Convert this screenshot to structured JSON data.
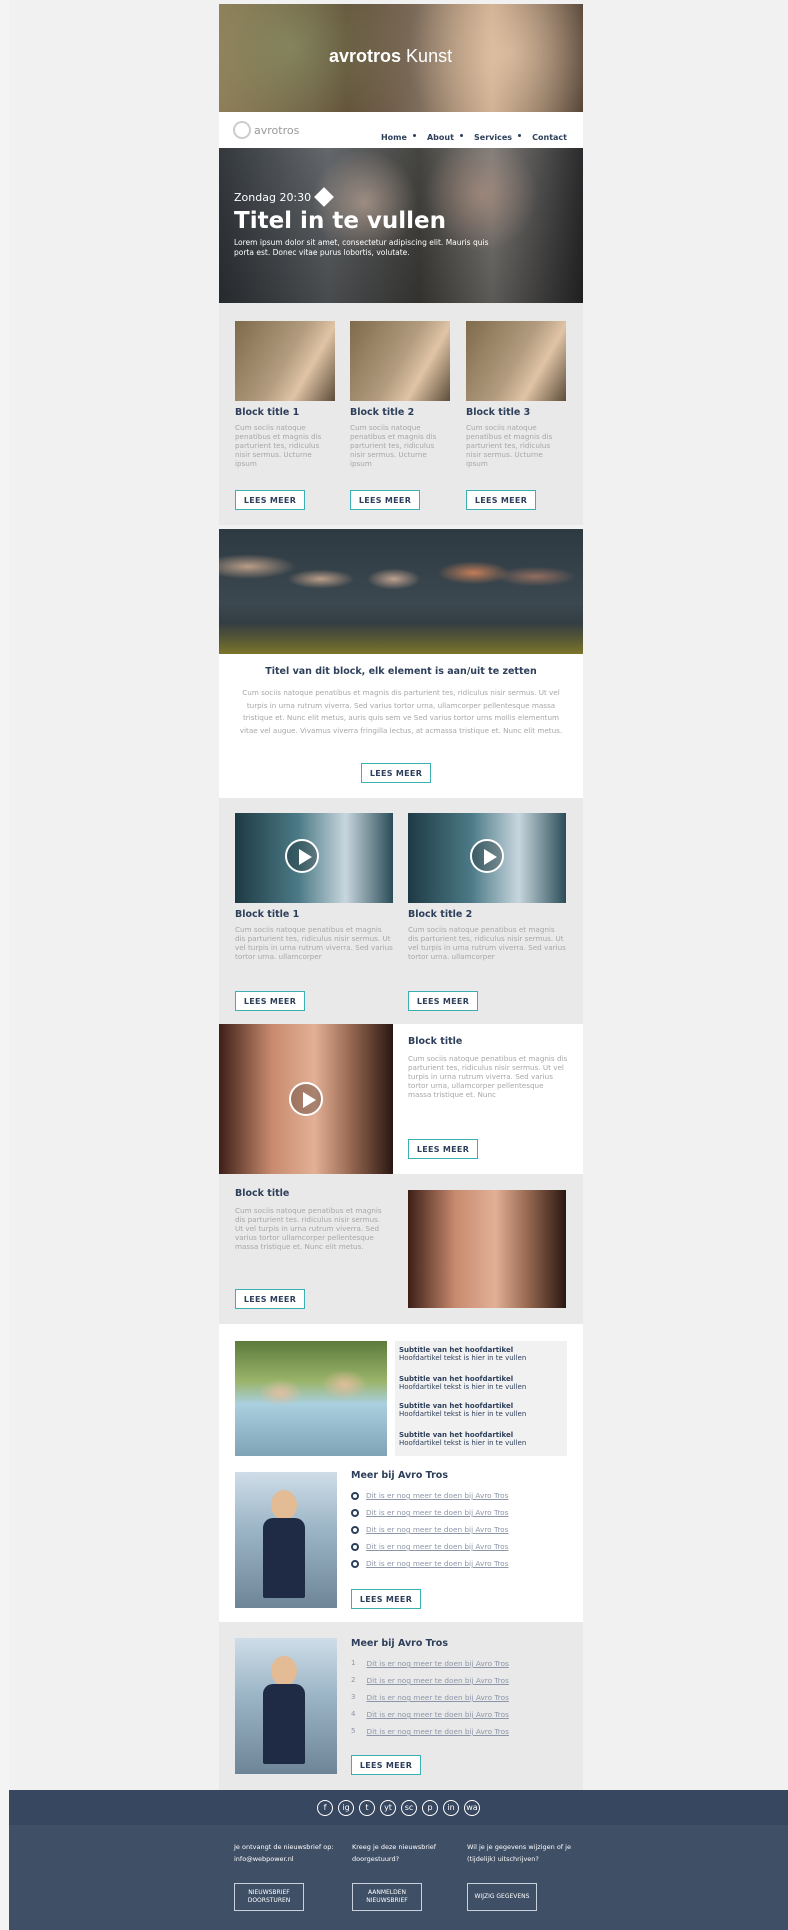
{
  "brand": {
    "logo_text": "avrotros",
    "header_title_bold": "avrotros",
    "header_title_light": "Kunst"
  },
  "nav": {
    "items": [
      "Home",
      "About",
      "Services",
      "Contact"
    ]
  },
  "hero": {
    "schedule": "Zondag 20:30",
    "title": "Titel in te vullen",
    "text": "Lorem ipsum dolor sit amet, consectetur adipiscing elit. Mauris quis porta est. Donec vitae purus lobortis, volutate."
  },
  "three_col": {
    "blocks": [
      {
        "title": "Block title 1",
        "text": "Cum sociis natoque penatibus et magnis dis parturient tes, ridiculus nisir sermus. Ucturne ipsum",
        "button": "LEES MEER"
      },
      {
        "title": "Block title 2",
        "text": "Cum sociis natoque penatibus et magnis dis parturient tes, ridiculus nisir sermus. Ucturne ipsum",
        "button": "LEES MEER"
      },
      {
        "title": "Block title 3",
        "text": "Cum sociis natoque penatibus et magnis dis parturient tes, ridiculus nisir sermus. Ucturne ipsum",
        "button": "LEES MEER"
      }
    ]
  },
  "feature": {
    "title": "Titel van dit block, elk element is aan/uit te zetten",
    "text": "Cum sociis natoque penatibus et magnis dis parturient tes, ridiculus nisir sermus. Ut vel turpis in urna rutrum viverra. Sed varius tortor urna, ullamcorper pellentesque massa tristique et. Nunc elit metus, auris quis sem ve Sed varius tortor urns mollis elementum vitae vel augue. Vivamus viverra fringilla lectus, at acmassa tristique et. Nunc elit metus.",
    "button": "LEES MEER"
  },
  "two_col": {
    "blocks": [
      {
        "title": "Block title 1",
        "text": "Cum sociis natoque penatibus et magnis dis parturient tes, ridiculus nisir sermus. Ut vel turpis in urna rutrum viverra. Sed varius tortor urna. ullamcorper",
        "button": "LEES MEER"
      },
      {
        "title": "Block title 2",
        "text": "Cum sociis natoque penatibus et magnis dis parturient tes, ridiculus nisir sermus. Ut vel turpis in urna rutrum viverra. Sed varius tortor urna. ullamcorper",
        "button": "LEES MEER"
      }
    ]
  },
  "split1": {
    "title": "Block title",
    "text": "Cum sociis natoque penatibus et magnis dis parturient tes, ridiculus nisir sermus. Ut vel turpis in urna rutrum viverra. Sed varius tortor urna, ullamcorper pellentesque massa tristique et. Nunc",
    "button": "LEES MEER"
  },
  "split2": {
    "title": "Block title",
    "text": "Cum sociis natoque penatibus et magnis dis parturient tes. ridiculus nisir sermus. Ut vel turpis in urna rutrum viverra. Sed varius tortor ullamcorper pellentesque massa tristique et. Nunc elit metus.",
    "button": "LEES MEER"
  },
  "articles": {
    "items": [
      {
        "subtitle": "Subtitle van het hoofdartikel",
        "text": "Hoofdartikel tekst is hier in te vullen"
      },
      {
        "subtitle": "Subtitle van het hoofdartikel",
        "text": "Hoofdartikel tekst is hier in te vullen"
      },
      {
        "subtitle": "Subtitle van het hoofdartikel",
        "text": "Hoofdartikel tekst is hier in te vullen"
      },
      {
        "subtitle": "Subtitle van het hoofdartikel",
        "text": "Hoofdartikel tekst is hier in te vullen"
      }
    ]
  },
  "meer1": {
    "title": "Meer bij Avro Tros",
    "links": [
      "Dit is er nog meer te doen bij Avro Tros",
      "Dit is er nog meer te doen bij Avro Tros",
      "Dit is er nog meer te doen bij Avro Tros",
      "Dit is er nog meer te doen bij Avro Tros",
      "Dit is er nog meer te doen bij Avro Tros"
    ],
    "button": "LEES MEER"
  },
  "meer2": {
    "title": "Meer bij Avro Tros",
    "numbers": [
      "1",
      "2",
      "3",
      "4",
      "5"
    ],
    "links": [
      "Dit is er nog meer te doen bij Avro Tros",
      "Dit is er nog meer te doen bij Avro Tros",
      "Dit is er nog meer te doen bij Avro Tros",
      "Dit is er nog meer te doen bij Avro Tros",
      "Dit is er nog meer te doen bij Avro Tros"
    ],
    "button": "LEES MEER"
  },
  "footer": {
    "social": [
      "f",
      "ig",
      "t",
      "yt",
      "sc",
      "p",
      "in",
      "wa"
    ],
    "col1": "Je ontvangt de nieuwsbrief op: info@webpower.nl",
    "col2": "Kreeg je deze nieuwsbrief doorgestuurd?",
    "col3": "Wil je je gegevens wijzigen of je (tijdelijk) uitschrijven?",
    "btn1": "NIEUWSBRIEF DOORSTUREN",
    "btn2": "AANMELDEN NIEUWSBRIEF",
    "btn3": "WIJZIG GEGEVENS"
  },
  "colors": {
    "navy": "#2d3f5a",
    "teal": "#3ab0b2",
    "footer": "#3f4f66"
  }
}
